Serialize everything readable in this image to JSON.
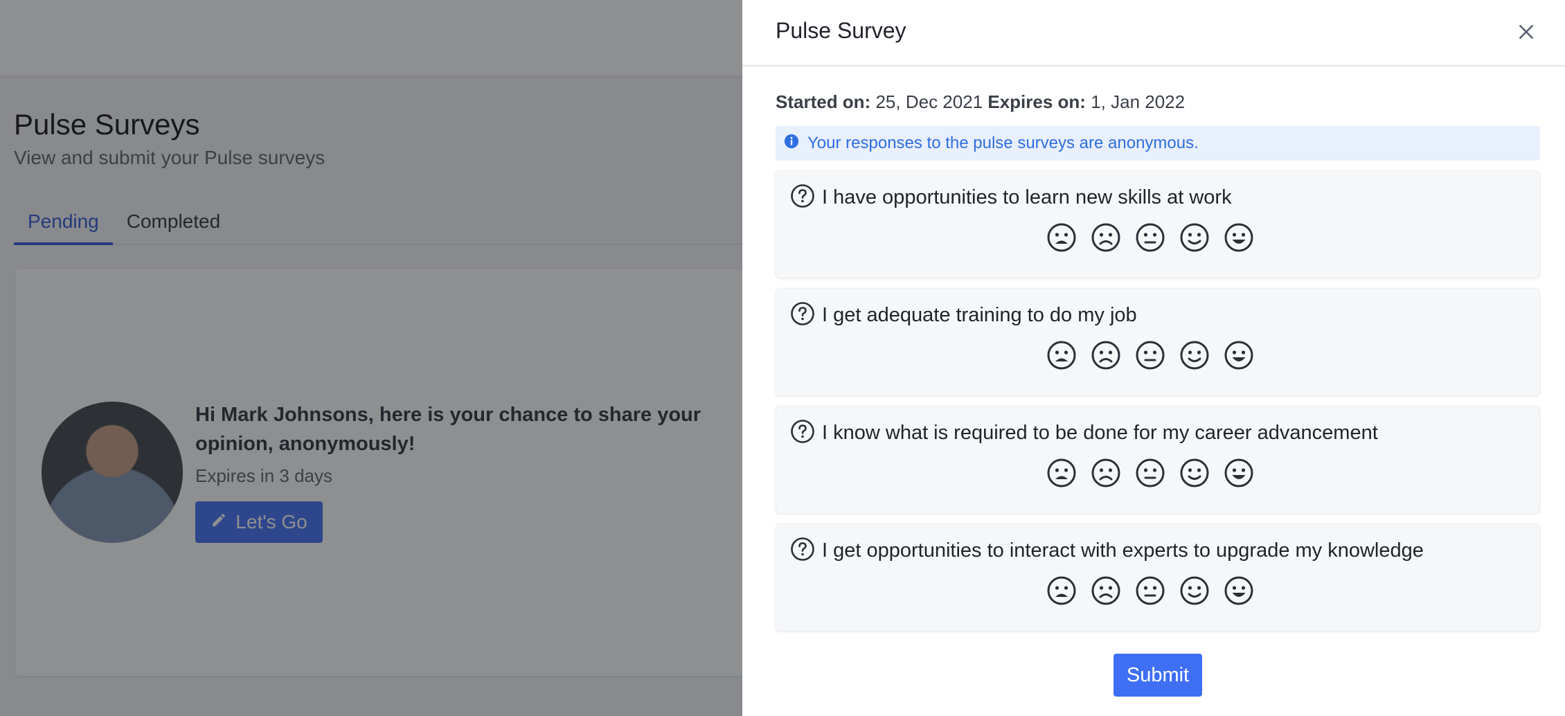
{
  "background": {
    "page_title": "Pulse Surveys",
    "page_subtitle": "View and submit your Pulse surveys",
    "tabs": [
      {
        "label": "Pending",
        "active": true
      },
      {
        "label": "Completed",
        "active": false
      }
    ],
    "card": {
      "greeting": "Hi Mark Johnsons, here is your chance to share your opinion, anonymously!",
      "expires": "Expires in 3 days",
      "button_label": "Let's Go",
      "button_icon": "pencil-icon"
    }
  },
  "drawer": {
    "title": "Pulse Survey",
    "close_icon": "close-icon",
    "started_label": "Started on:",
    "started_value": "25, Dec 2021",
    "expires_label": "Expires on:",
    "expires_value": "1, Jan 2022",
    "info_text": "Your responses to the pulse surveys are anonymous.",
    "info_icon": "info-circle-icon",
    "questions": [
      {
        "text": "I have opportunities to learn new skills at work"
      },
      {
        "text": "I get adequate training to do my job"
      },
      {
        "text": "I know what is required to be done for my career advancement"
      },
      {
        "text": "I get opportunities to interact with experts to upgrade my knowledge"
      }
    ],
    "rating_icons": [
      "very-sad-face-icon",
      "sad-face-icon",
      "neutral-face-icon",
      "smile-face-icon",
      "happy-face-icon"
    ],
    "submit_label": "Submit"
  },
  "colors": {
    "accent": "#3f6ff5",
    "info_bg": "#e8effd",
    "info_text": "#2f6fe0",
    "active_tab": "#2a55d6"
  }
}
